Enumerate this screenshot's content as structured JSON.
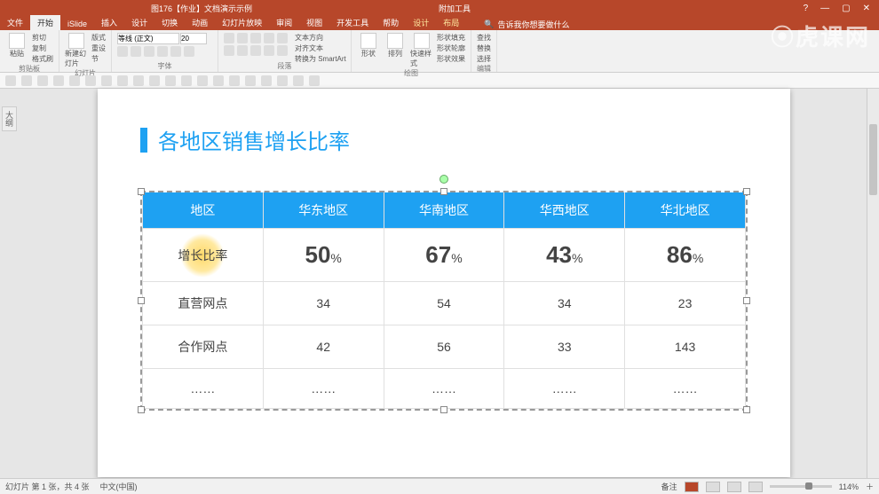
{
  "window": {
    "doc_title": "图176【作业】文档演示示例",
    "extra_tab": "附加工具",
    "controls": {
      "help": "?",
      "min": "—",
      "max": "▢",
      "close": "✕"
    }
  },
  "watermark": "⦿虎课网",
  "menubar": {
    "tabs": [
      "文件",
      "开始",
      "iSlide",
      "插入",
      "设计",
      "切换",
      "动画",
      "幻灯片放映",
      "审阅",
      "视图",
      "开发工具",
      "帮助",
      "设计",
      "布局"
    ],
    "active_index": 1,
    "highlight_indices": [
      12,
      13
    ],
    "search_placeholder": "告诉我你想要做什么"
  },
  "ribbon": {
    "groups": {
      "clipboard": {
        "label": "剪贴板",
        "paste": "粘贴",
        "items": [
          "剪切",
          "复制",
          "格式刷"
        ]
      },
      "slides": {
        "label": "幻灯片",
        "new": "新建幻灯片",
        "items": [
          "版式",
          "重设",
          "节"
        ]
      },
      "font": {
        "label": "字体",
        "name": "等线 (正文)",
        "size": "20"
      },
      "paragraph": {
        "label": "段落",
        "items": [
          "文本方向",
          "对齐文本",
          "转换为 SmartArt"
        ]
      },
      "drawing": {
        "label": "绘图",
        "shapes": "形状",
        "arrange": "排列",
        "quick": "快速样式",
        "items": [
          "形状填充",
          "形状轮廓",
          "形状效果"
        ]
      },
      "editing": {
        "label": "编辑",
        "items": [
          "查找",
          "替换",
          "选择"
        ]
      }
    }
  },
  "sidetab": "大纲",
  "slide": {
    "title": "各地区销售增长比率",
    "chart_data": {
      "type": "table",
      "headers": [
        "地区",
        "华东地区",
        "华南地区",
        "华西地区",
        "华北地区"
      ],
      "rows": [
        {
          "label": "增长比率",
          "values": [
            "50",
            "67",
            "43",
            "86"
          ],
          "percent": true,
          "emphasis": true
        },
        {
          "label": "直营网点",
          "values": [
            "34",
            "54",
            "34",
            "23"
          ]
        },
        {
          "label": "合作网点",
          "values": [
            "42",
            "56",
            "33",
            "143"
          ]
        },
        {
          "label": "……",
          "values": [
            "……",
            "……",
            "……",
            "……"
          ]
        }
      ]
    }
  },
  "statusbar": {
    "slide_info": "幻灯片 第 1 张，共 4 张",
    "language": "中文(中国)",
    "notes": "备注",
    "zoom": "114%",
    "fit": "＋"
  },
  "pct_symbol": "%"
}
